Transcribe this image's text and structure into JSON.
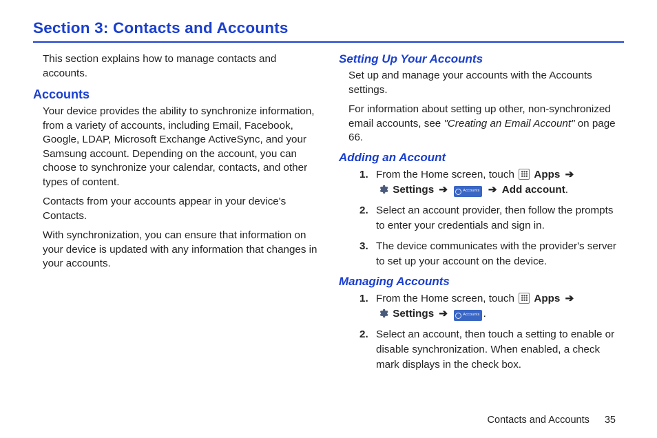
{
  "section_title": "Section 3: Contacts and Accounts",
  "intro": "This section explains how to manage contacts and accounts.",
  "left": {
    "h2": "Accounts",
    "p1": "Your device provides the ability to synchronize information, from a variety of accounts, including Email, Facebook, Google, LDAP, Microsoft Exchange ActiveSync, and your Samsung account. Depending on the account, you can choose to synchronize your calendar, contacts, and other types of content.",
    "p2": "Contacts from your accounts appear in your device's Contacts.",
    "p3": "With synchronization, you can ensure that information on your device is updated with any information that changes in your accounts."
  },
  "right": {
    "setup": {
      "h3": "Setting Up Your Accounts",
      "p1": "Set up and manage your accounts with the Accounts settings.",
      "p2a": "For information about setting up other, non-synchronized email accounts, see ",
      "p2_ref": "\"Creating an Email Account\"",
      "p2b": " on page 66."
    },
    "adding": {
      "h3": "Adding an Account",
      "step1_a": "From the Home screen, touch ",
      "apps_label": "Apps",
      "arrow": "➔",
      "settings_label": "Settings",
      "accounts_icon_label": "Accounts",
      "add_account_label": "Add account",
      "step2": "Select an account provider, then follow the prompts to enter your credentials and sign in.",
      "step3": "The device communicates with the provider's server to set up your account on the device."
    },
    "managing": {
      "h3": "Managing Accounts",
      "step1_a": "From the Home screen, touch ",
      "step2": "Select an account, then touch a setting to enable or disable synchronization. When enabled, a check mark displays in the check box."
    },
    "nums": {
      "n1": "1.",
      "n2": "2.",
      "n3": "3."
    }
  },
  "footer": {
    "title": "Contacts and Accounts",
    "page": "35"
  }
}
